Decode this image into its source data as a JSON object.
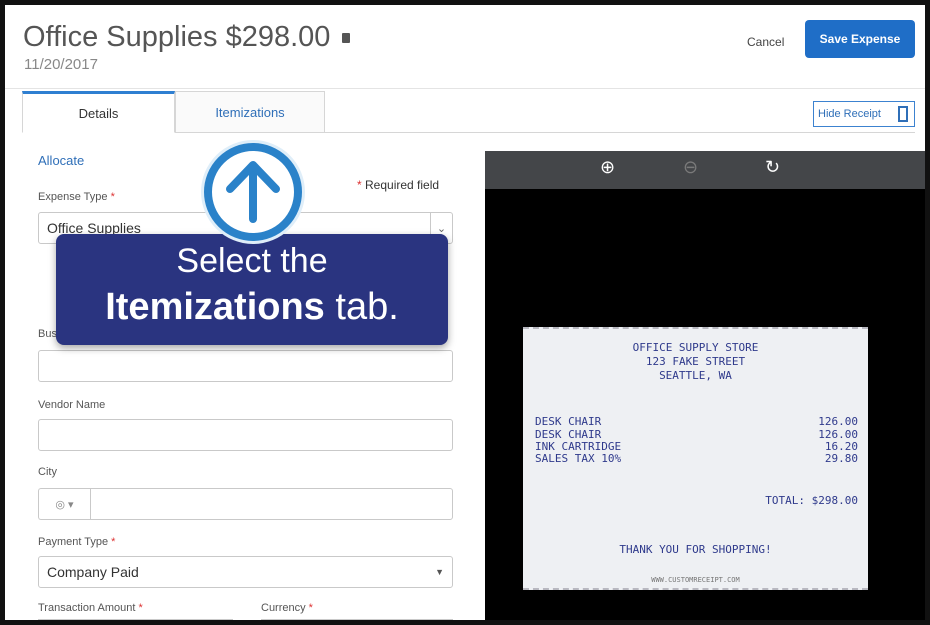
{
  "header": {
    "title": "Office Supplies $298.00",
    "date": "11/20/2017",
    "cancel_label": "Cancel",
    "save_label": "Save Expense"
  },
  "tabs": [
    {
      "label": "Details",
      "active": true
    },
    {
      "label": "Itemizations",
      "active": false
    }
  ],
  "hide_receipt_label": "Hide Receipt",
  "form": {
    "allocate_label": "Allocate",
    "required_label": "Required field",
    "expense_type": {
      "label": "Expense Type",
      "value": "Office Supplies"
    },
    "business_purpose": {
      "label": "Business Purpose",
      "value": ""
    },
    "vendor_name": {
      "label": "Vendor Name",
      "value": ""
    },
    "city": {
      "label": "City",
      "value": ""
    },
    "payment_type": {
      "label": "Payment Type",
      "value": "Company Paid"
    },
    "transaction_amount": {
      "label": "Transaction Amount"
    },
    "currency": {
      "label": "Currency"
    }
  },
  "receipt": {
    "store_name": "OFFICE SUPPLY STORE",
    "address": "123 FAKE STREET",
    "city": "SEATTLE, WA",
    "items": [
      {
        "name": "DESK CHAIR",
        "amount": "126.00"
      },
      {
        "name": "DESK CHAIR",
        "amount": "126.00"
      },
      {
        "name": "INK CARTRIDGE",
        "amount": "16.20"
      },
      {
        "name": "SALES TAX 10%",
        "amount": "29.80"
      }
    ],
    "total": "TOTAL: $298.00",
    "thanks": "THANK YOU FOR SHOPPING!",
    "footer": "WWW.CUSTOMRECEIPT.COM"
  },
  "callout": {
    "line1": "Select the",
    "line2_bold": "Itemizations",
    "line2_rest": " tab."
  },
  "colors": {
    "primary": "#1f6ec7",
    "callout_bg": "#2a3480",
    "arrow_ring": "#2a82c9",
    "receipt_ink": "#2f3a8c"
  }
}
